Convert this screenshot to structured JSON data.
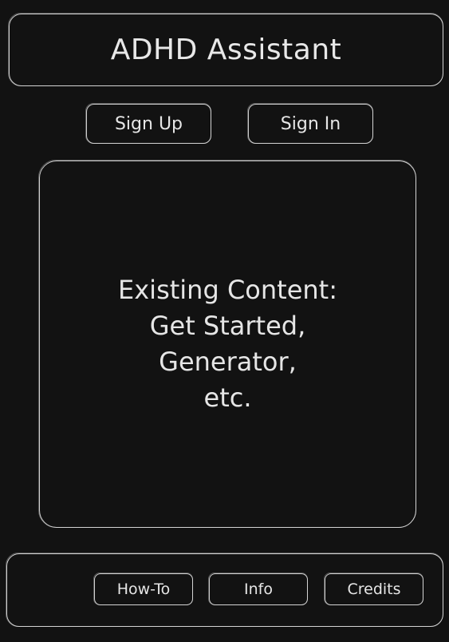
{
  "header": {
    "title": "ADHD Assistant"
  },
  "auth": {
    "sign_up_label": "Sign Up",
    "sign_in_label": "Sign In"
  },
  "main": {
    "content_lines": [
      "Existing Content:",
      "Get Started,",
      "Generator,",
      "etc."
    ]
  },
  "footer": {
    "links": [
      {
        "label": "How-To"
      },
      {
        "label": "Info"
      },
      {
        "label": "Credits"
      }
    ]
  },
  "colors": {
    "background": "#121212",
    "stroke": "#cfcfcf",
    "text": "#e6e6e6"
  }
}
